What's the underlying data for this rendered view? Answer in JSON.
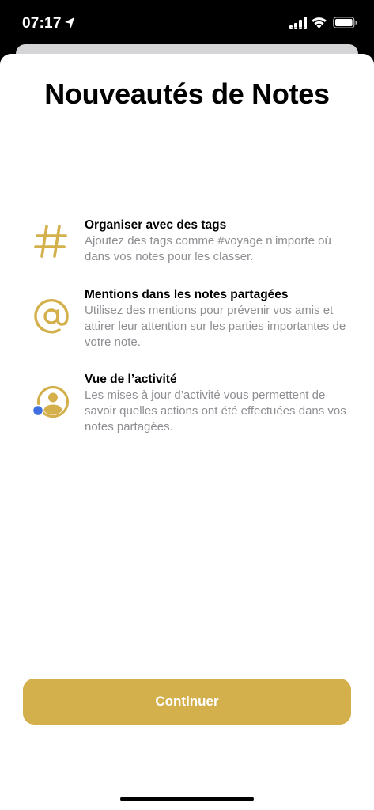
{
  "status_bar": {
    "time": "07:17",
    "icons": [
      "location-arrow-icon",
      "cellular-signal-icon",
      "wifi-icon",
      "battery-icon"
    ]
  },
  "title": "Nouveautés de Notes",
  "features": [
    {
      "icon": "hashtag-icon",
      "title": "Organiser avec des tags",
      "description": "Ajoutez des tags comme #voyage n’importe où dans vos notes pour les classer."
    },
    {
      "icon": "at-sign-icon",
      "title": "Mentions dans les notes partagées",
      "description": "Utilisez des mentions pour prévenir vos amis et attirer leur attention sur les parties importantes de votre note."
    },
    {
      "icon": "activity-person-icon",
      "title": "Vue de l’activité",
      "description": "Les mises à jour d’activité vous permettent de savoir quelles actions ont été effectuées dans vos notes partagées."
    }
  ],
  "continue_label": "Continuer",
  "colors": {
    "accent": "#d4b04c",
    "description_text": "#8e8e93",
    "activity_dot": "#3f6fe0"
  }
}
